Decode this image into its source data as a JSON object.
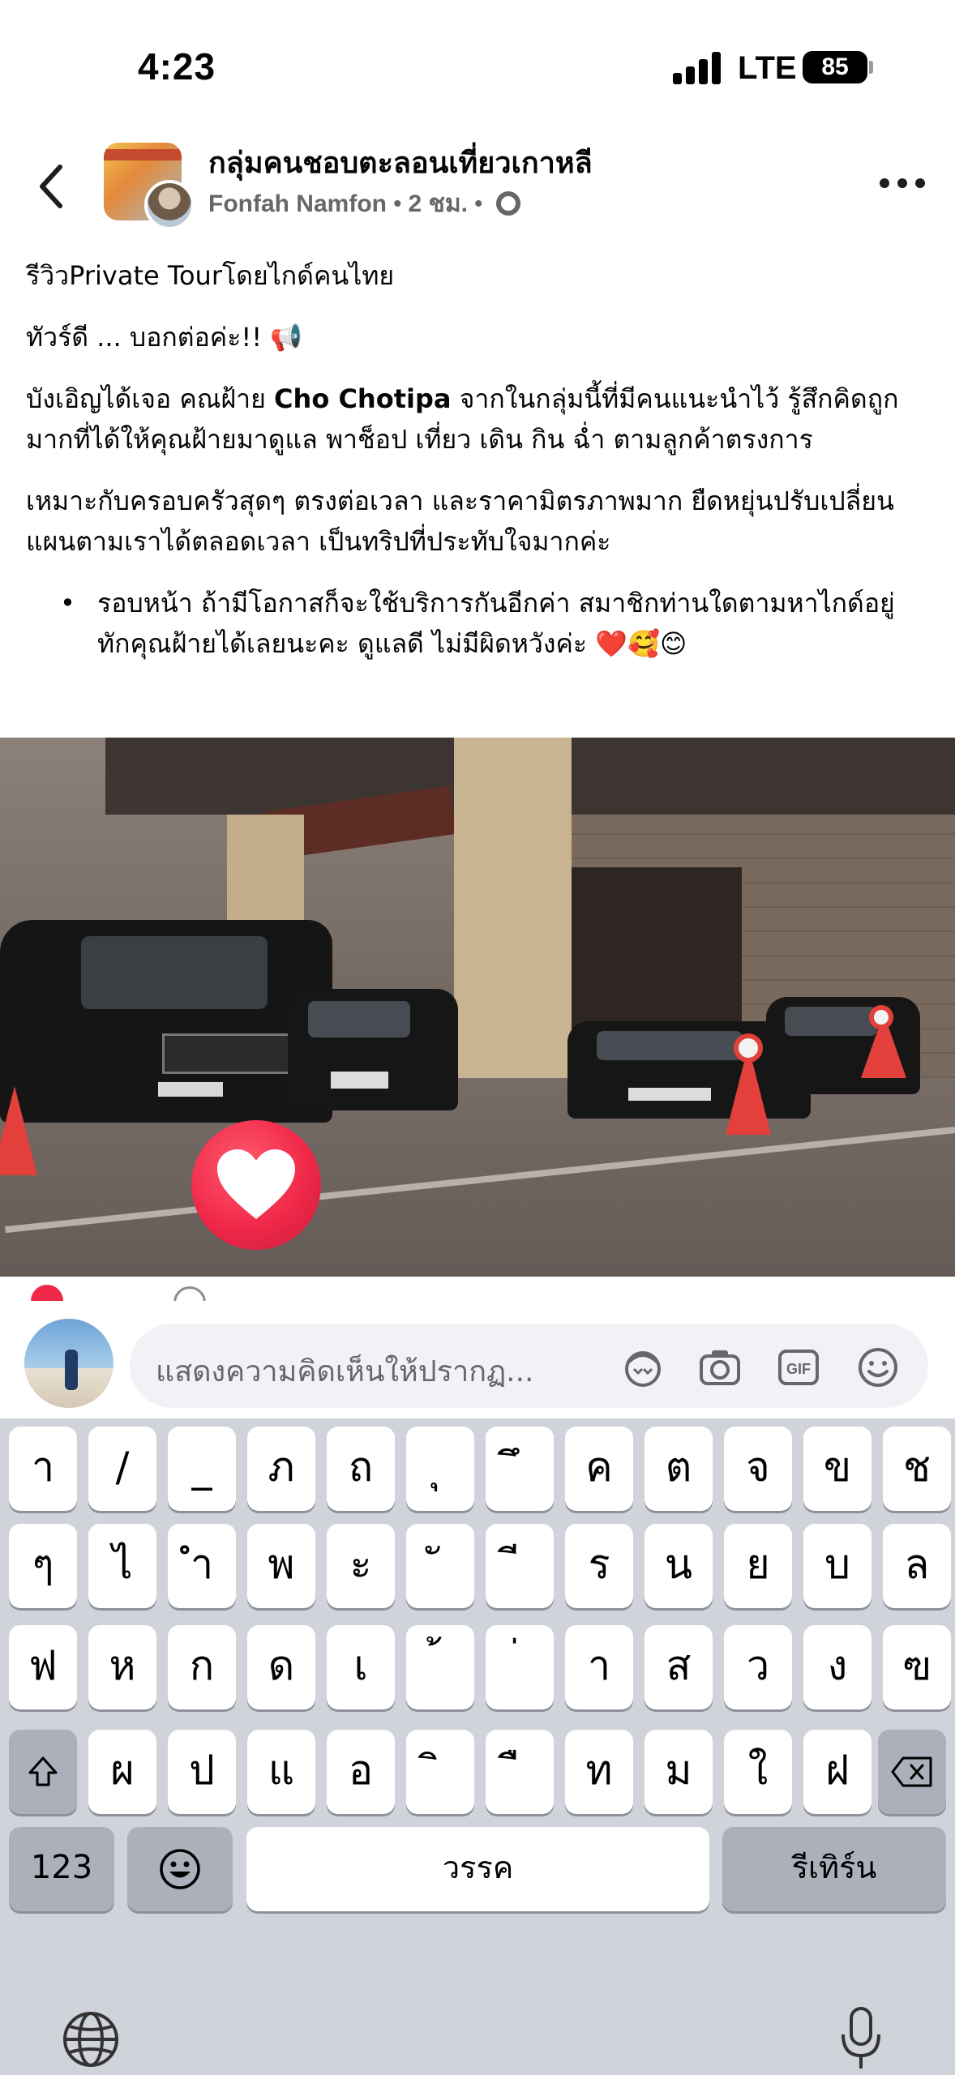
{
  "status_bar": {
    "time": "4:23",
    "network": "LTE",
    "battery": "85"
  },
  "post": {
    "group_name": "กลุ่มคนชอบตะลอนเที่ยวเกาหลี",
    "author": "Fonfah Namfon",
    "time_ago": "2 ชม.",
    "paragraphs": {
      "p1": "รีวิวPrivate Tourโดยไกด์คนไทย",
      "p2": "ทัวร์ดี ... บอกต่อค่ะ!! 📢",
      "p3_before": "บังเอิญได้เจอ คณฝ้าย ",
      "p3_bold": "Cho Chotipa",
      "p3_after": " จากในกลุ่มนี้ที่มีคนแนะนำไว้ รู้สึกคิดถูกมากที่ได้ให้คุณฝ้ายมาดูแล พาช็อป เที่ยว เดิน กิน ฉ่ำ ตามลูกค้าตรงการ",
      "p4": "เหมาะกับครอบครัวสุดๆ  ตรงต่อเวลา และราคามิตรภาพมาก  ยืดหยุ่นปรับเปลี่ยนแผนตามเราได้ตลอดเวลา  เป็นทริปที่ประทับใจมากค่ะ",
      "bullet1": "รอบหน้า ถ้ามีโอกาสก็จะใช้บริการกันอีกค่า  สมาชิกท่านใดตามหาไกด์อยู่ ทักคุณฝ้ายได้เลยนะคะ ดูแลดี ไม่มีผิดหวังค่ะ ❤️🥰😊"
    }
  },
  "comment": {
    "placeholder": "แสดงความคิดเห็นให้ปรากฏ..."
  },
  "keyboard": {
    "row1": [
      "า",
      "/",
      "_",
      "ภ",
      "ถ",
      "ุ",
      "ึ",
      "ค",
      "ต",
      "จ",
      "ข",
      "ช"
    ],
    "row2": [
      "ๆ",
      "ไ",
      "ำ",
      "พ",
      "ะ",
      "ั",
      "ี",
      "ร",
      "น",
      "ย",
      "บ",
      "ล"
    ],
    "row3": [
      "ฟ",
      "ห",
      "ก",
      "ด",
      "เ",
      "้",
      "่",
      "า",
      "ส",
      "ว",
      "ง",
      "ฃ"
    ],
    "row4": [
      "ผ",
      "ป",
      "แ",
      "อ",
      "ิ",
      "ื",
      "ท",
      "ม",
      "ใ",
      "ฝ"
    ],
    "numbers_label": "123",
    "space_label": "วรรค",
    "return_label": "รีเทิร์น"
  }
}
